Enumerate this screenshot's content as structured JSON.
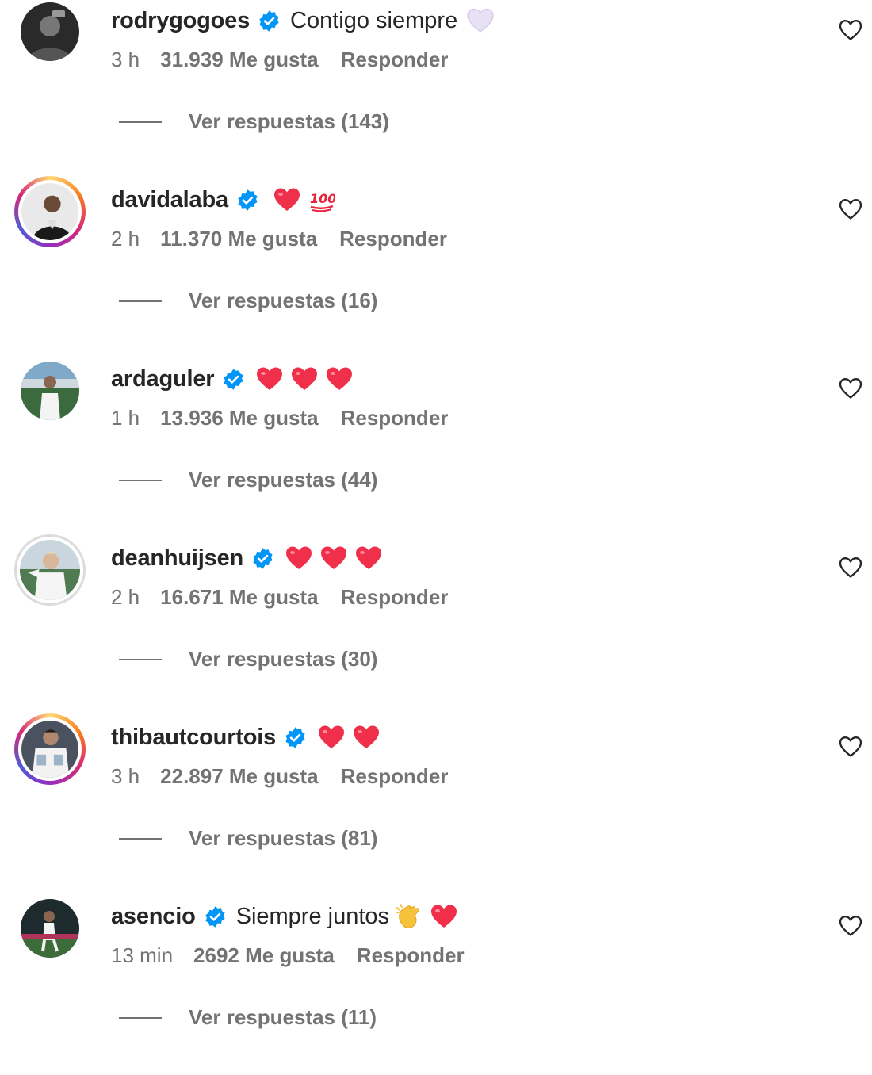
{
  "common": {
    "likes_suffix": "Me gusta",
    "reply_label": "Responder",
    "view_replies_prefix": "Ver respuestas"
  },
  "comments": [
    {
      "username": "rodrygogoes",
      "text": "Contigo siempre",
      "emojis": [
        "white-heart"
      ],
      "time": "3 h",
      "likes": "31.939 Me gusta",
      "reply": "Responder",
      "view_replies": "Ver respuestas (143)",
      "verified": true
    },
    {
      "username": "davidalaba",
      "text": "",
      "emojis": [
        "red-heart",
        "hundred-points"
      ],
      "time": "2 h",
      "likes": "11.370 Me gusta",
      "reply": "Responder",
      "view_replies": "Ver respuestas (16)",
      "verified": true
    },
    {
      "username": "ardaguler",
      "text": "",
      "emojis": [
        "red-heart",
        "red-heart",
        "red-heart"
      ],
      "time": "1 h",
      "likes": "13.936 Me gusta",
      "reply": "Responder",
      "view_replies": "Ver respuestas (44)",
      "verified": true
    },
    {
      "username": "deanhuijsen",
      "text": "",
      "emojis": [
        "red-heart",
        "red-heart",
        "red-heart"
      ],
      "time": "2 h",
      "likes": "16.671 Me gusta",
      "reply": "Responder",
      "view_replies": "Ver respuestas (30)",
      "verified": true
    },
    {
      "username": "thibautcourtois",
      "text": "",
      "emojis": [
        "red-heart",
        "red-heart"
      ],
      "time": "3 h",
      "likes": "22.897 Me gusta",
      "reply": "Responder",
      "view_replies": "Ver respuestas (81)",
      "verified": true
    },
    {
      "username": "asencio",
      "text": "Siempre juntos",
      "emojis": [
        "clapping-hands",
        "red-heart"
      ],
      "time": "13 min",
      "likes": "2692 Me gusta",
      "reply": "Responder",
      "view_replies": "Ver respuestas (11)",
      "verified": true
    }
  ],
  "colors": {
    "text_primary": "#262626",
    "text_secondary": "#737373",
    "verified_blue": "#0095f6",
    "heart_red": "#f0304a"
  }
}
